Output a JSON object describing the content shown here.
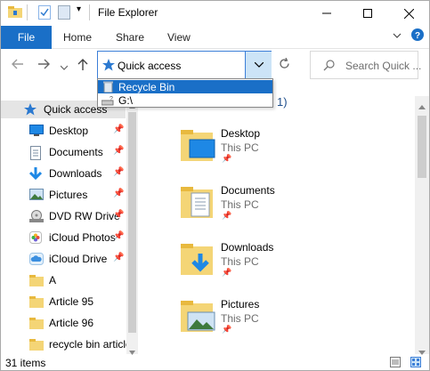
{
  "window": {
    "title": "File Explorer"
  },
  "colors": {
    "accent": "#1a6fc7",
    "selection": "#cce4f7",
    "folder": "#f4d576"
  },
  "ribbon": {
    "file_tab": "File",
    "tabs": [
      "Home",
      "Share",
      "View"
    ],
    "expand_icon": "chevron-down-icon",
    "help_icon": "help-icon"
  },
  "navigation": {
    "back_icon": "back-arrow-icon",
    "forward_icon": "forward-arrow-icon",
    "recent_icon": "chevron-down-icon",
    "up_icon": "up-arrow-icon"
  },
  "address": {
    "value": "Quick access"
  },
  "search": {
    "placeholder": "Search Quick ..."
  },
  "address_dropdown": {
    "items": [
      {
        "label": "Recycle Bin",
        "selected": true
      },
      {
        "label": "G:\\",
        "selected": false
      }
    ]
  },
  "navpane": {
    "items": [
      {
        "label": "Quick access",
        "icon": "star-icon",
        "pinned": false
      },
      {
        "label": "Desktop",
        "icon": "desktop-icon",
        "pinned": true
      },
      {
        "label": "Documents",
        "icon": "documents-icon",
        "pinned": true
      },
      {
        "label": "Downloads",
        "icon": "download-icon",
        "pinned": true
      },
      {
        "label": "Pictures",
        "icon": "pictures-icon",
        "pinned": true
      },
      {
        "label": "DVD RW Drive",
        "icon": "dvd-drive-icon",
        "pinned": true
      },
      {
        "label": "iCloud Photos",
        "icon": "icloud-photos-icon",
        "pinned": true
      },
      {
        "label": "iCloud Drive",
        "icon": "icloud-drive-icon",
        "pinned": true
      },
      {
        "label": "A",
        "icon": "folder-icon",
        "pinned": false
      },
      {
        "label": "Article 95",
        "icon": "folder-icon",
        "pinned": false
      },
      {
        "label": "Article 96",
        "icon": "folder-icon",
        "pinned": false
      },
      {
        "label": "recycle bin article",
        "icon": "folder-icon",
        "pinned": false
      }
    ]
  },
  "main": {
    "group_fragment": "1)",
    "items": [
      {
        "name": "Desktop",
        "location": "This PC",
        "icon": "desktop-folder-icon"
      },
      {
        "name": "Documents",
        "location": "This PC",
        "icon": "documents-folder-icon"
      },
      {
        "name": "Downloads",
        "location": "This PC",
        "icon": "downloads-folder-icon"
      },
      {
        "name": "Pictures",
        "location": "This PC",
        "icon": "pictures-folder-icon"
      }
    ]
  },
  "status": {
    "count": "31 items"
  }
}
